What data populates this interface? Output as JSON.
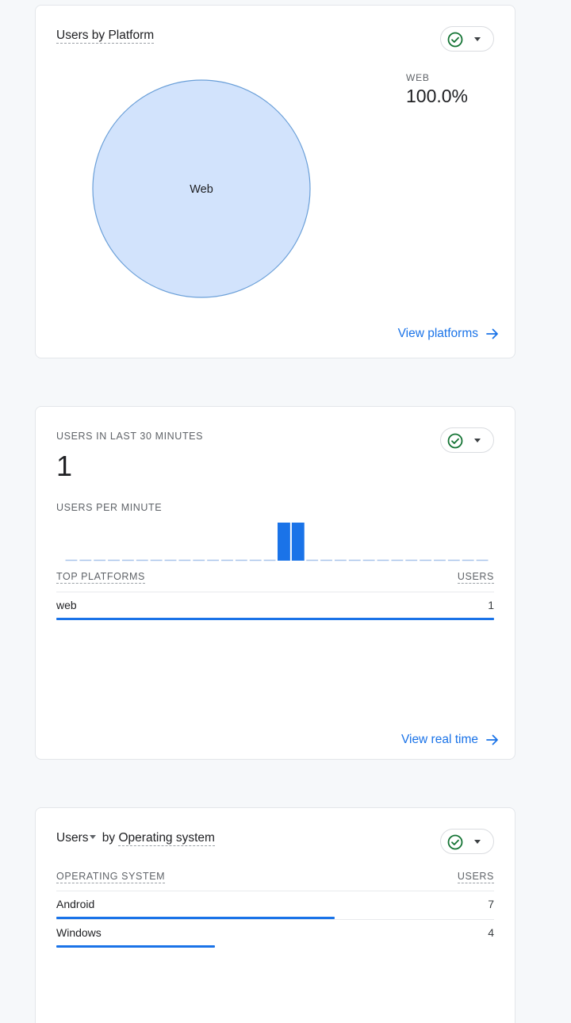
{
  "card_platform": {
    "title": "Users by Platform",
    "legend_label": "WEB",
    "legend_value": "100.0%",
    "pie_slice_label": "Web",
    "pie_color": "#d2e3fc",
    "pie_stroke": "#6a9fd8",
    "link": "View platforms"
  },
  "card_realtime": {
    "label": "USERS IN LAST 30 MINUTES",
    "value": "1",
    "per_minute_label": "USERS PER MINUTE",
    "per_minute_values": [
      0,
      0,
      0,
      0,
      0,
      0,
      0,
      0,
      0,
      0,
      0,
      0,
      0,
      0,
      0,
      1,
      1,
      0,
      0,
      0,
      0,
      0,
      0,
      0,
      0,
      0,
      0,
      0,
      0,
      0
    ],
    "table_header_left": "TOP PLATFORMS",
    "table_header_right": "USERS",
    "rows": [
      {
        "name": "web",
        "value": "1",
        "share": 1.0
      }
    ],
    "link": "View real time"
  },
  "card_os": {
    "title_metric": "Users",
    "title_rest": "by",
    "title_dimension": "Operating system",
    "table_header_left": "OPERATING SYSTEM",
    "table_header_right": "USERS",
    "rows": [
      {
        "name": "Android",
        "value": "7",
        "share": 1.0
      },
      {
        "name": "Windows",
        "value": "4",
        "share": 0.571
      }
    ]
  },
  "colors": {
    "accent": "#1a73e8",
    "check_green": "#137333"
  },
  "icons": {
    "status": "check-circle-icon",
    "menu": "caret-down-icon",
    "link": "arrow-right-icon"
  }
}
